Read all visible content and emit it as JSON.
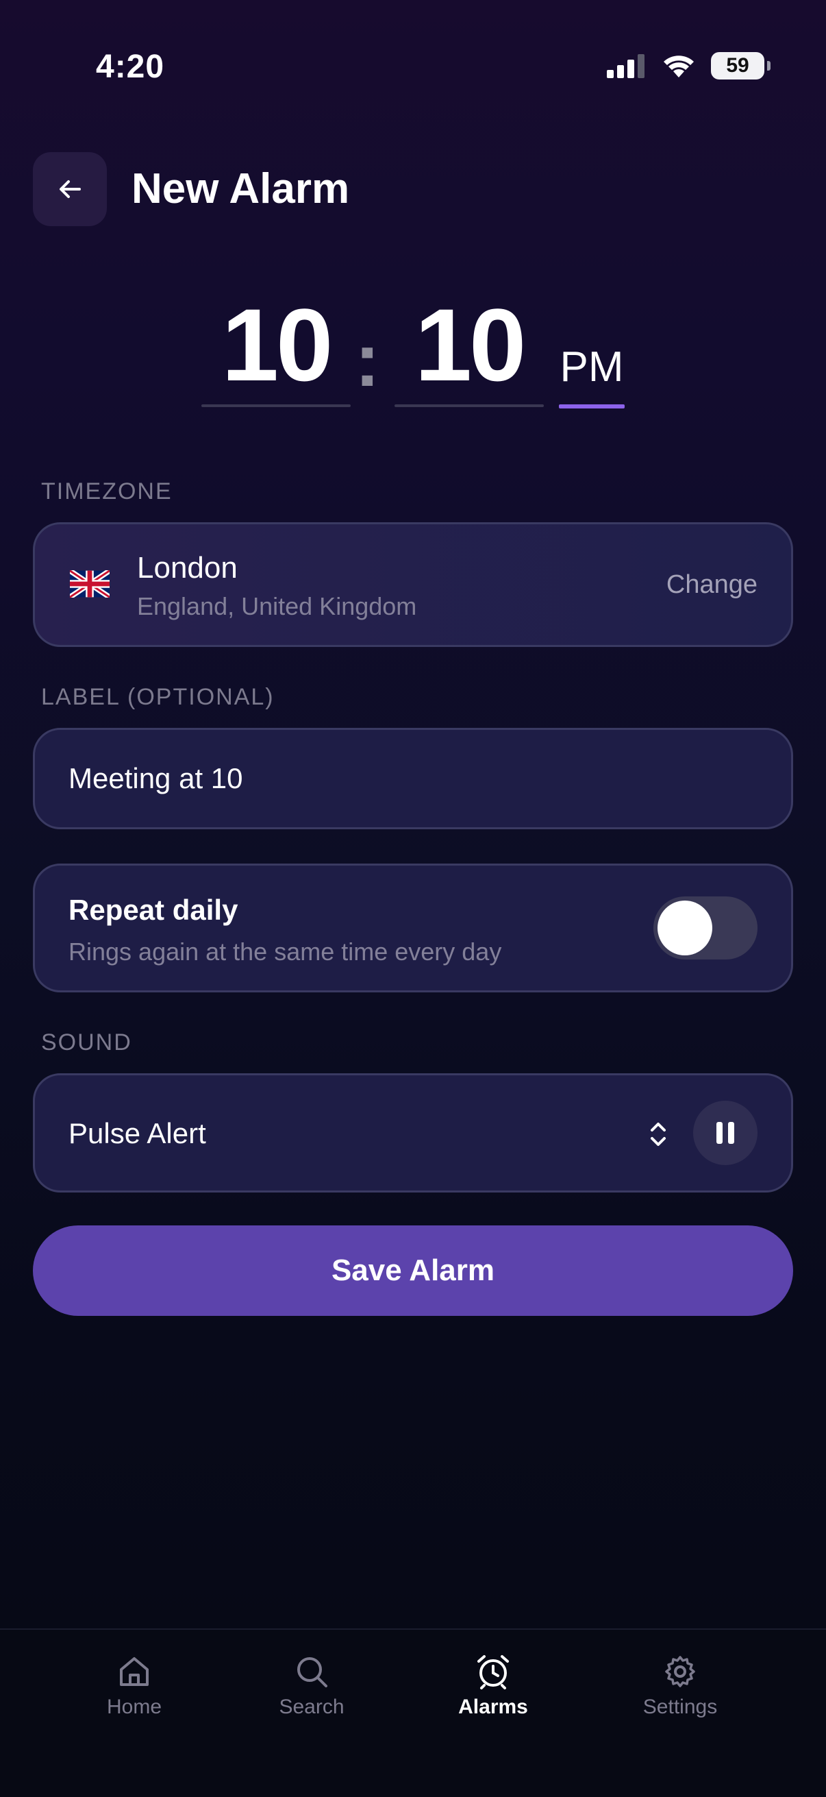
{
  "status": {
    "time": "4:20",
    "battery": "59"
  },
  "header": {
    "title": "New Alarm"
  },
  "time_picker": {
    "hour": "10",
    "minute": "10",
    "separator": ":",
    "period": "PM"
  },
  "timezone": {
    "section_label": "TIMEZONE",
    "city": "London",
    "region": "England, United Kingdom",
    "change_label": "Change"
  },
  "label": {
    "section_label": "LABEL (OPTIONAL)",
    "value": "Meeting at 10"
  },
  "repeat": {
    "title": "Repeat daily",
    "subtitle": "Rings again at the same time every day",
    "enabled": false
  },
  "sound": {
    "section_label": "SOUND",
    "value": "Pulse Alert"
  },
  "save_label": "Save Alarm",
  "tabs": [
    {
      "label": "Home",
      "icon": "home-icon"
    },
    {
      "label": "Search",
      "icon": "search-icon"
    },
    {
      "label": "Alarms",
      "icon": "alarm-clock-icon",
      "active": true
    },
    {
      "label": "Settings",
      "icon": "gear-icon"
    }
  ],
  "colors": {
    "accent": "#8d63ea",
    "button": "#5c43ac",
    "card": "#1e1d46"
  }
}
